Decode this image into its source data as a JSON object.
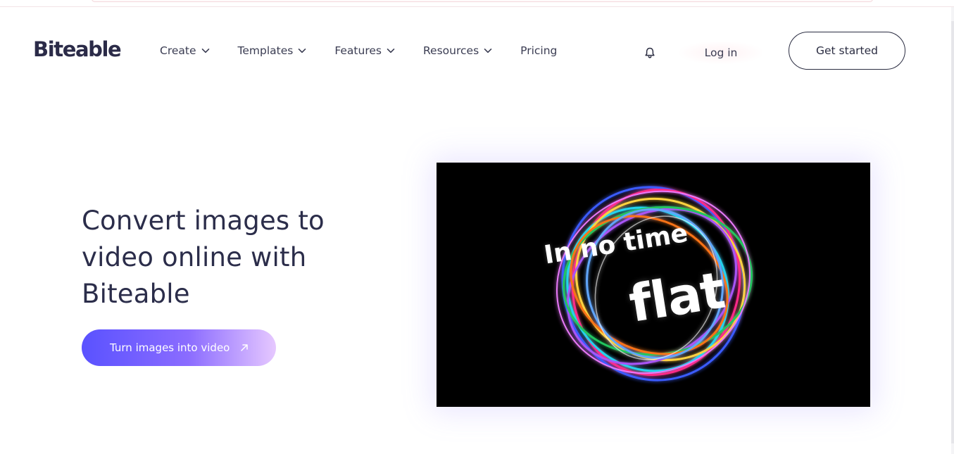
{
  "brand": {
    "logo_text": "Biteable",
    "logo_color": "#2b2b48"
  },
  "nav": {
    "items": [
      {
        "label": "Create",
        "has_dropdown": true
      },
      {
        "label": "Templates",
        "has_dropdown": true
      },
      {
        "label": "Features",
        "has_dropdown": true
      },
      {
        "label": "Resources",
        "has_dropdown": true
      },
      {
        "label": "Pricing",
        "has_dropdown": false
      }
    ],
    "notification_icon": "bell-icon",
    "login_label": "Log in",
    "get_started_label": "Get started"
  },
  "hero": {
    "title_lines": [
      "Convert images to",
      "video online with",
      "Biteable"
    ],
    "cta_label": "Turn images into video",
    "cta_icon": "arrow-up-right-icon",
    "cta_gradient": [
      "#5a52ff",
      "#8b6cff",
      "#e6c8ff"
    ]
  },
  "video": {
    "overlay_line_1": "In no time",
    "overlay_line_2": "flat",
    "background": "#000000"
  }
}
